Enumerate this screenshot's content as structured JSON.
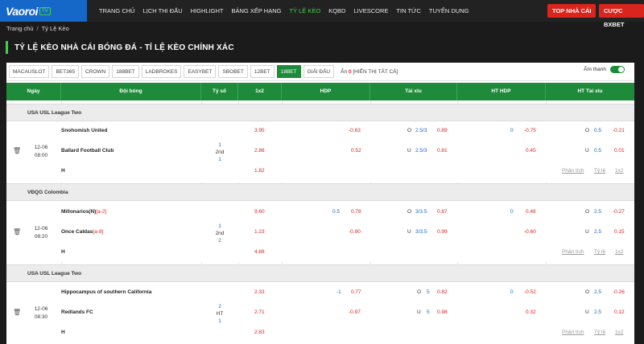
{
  "logo": {
    "text": "Vaoroi",
    "tv": "TV"
  },
  "nav": [
    "TRANG CHỦ",
    "LỊCH THI ĐẤU",
    "HIGHLIGHT",
    "BẢNG XẾP HẠNG",
    "TỶ LỆ KÈO",
    "KQBD",
    "LIVESCORE",
    "TIN TỨC",
    "TUYỂN DỤNG"
  ],
  "nav_active_index": 4,
  "buttons": {
    "top_nha_cai": "TOP NHÀ CÁI",
    "cuoc_bxbet": "CƯỢC BXBET"
  },
  "breadcrumb": {
    "home": "Trang chủ",
    "sep": "/",
    "current": "Tỷ Lệ Kèo"
  },
  "page_title": "TỶ LỆ KÈO NHÀ CÁI BÓNG ĐÁ - TỈ LỆ KÈO CHÍNH XÁC",
  "bookies": [
    "MACAUSLOT",
    "BET365",
    "CROWN",
    "188BET",
    "LADBROKES",
    "EASYBET",
    "SBOBET",
    "12BET",
    "18BET",
    "GIẢI ĐẤU"
  ],
  "bookie_active_index": 8,
  "hide": {
    "label": "Ẩn",
    "count": "0",
    "show_all": "[HIỂN THỊ TẤT CẢ]"
  },
  "sound_label": "Âm thanh",
  "headers": {
    "ngay": "Ngày",
    "doi_bong": "Đội bóng",
    "ty_so": "Tỷ số",
    "x12": "1x2",
    "hdp": "HDP",
    "tai_xiu": "Tài xỉu",
    "ht_hdp": "HT HDP",
    "ht_tai_xiu": "HT Tài xỉu"
  },
  "links": {
    "phan_tich": "Phân tích",
    "ty_le": "Tỷ lệ",
    "x12": "1x2"
  },
  "colors": {
    "green": "#1d8b3a",
    "red": "#d9251d",
    "blue": "#1668c8",
    "nav_bg": "#222222"
  },
  "leagues": [
    {
      "name": "USA USL League Two",
      "date": "12-06",
      "time": "08:00",
      "home": "Snohomish United",
      "home_card": "",
      "away": "Ballard Football Club",
      "away_card": "",
      "draw_label": "H",
      "score_home": "1",
      "period": "2nd",
      "score_away": "1",
      "o1x2": [
        "3.95",
        "2.86",
        "1.82"
      ],
      "hdp": {
        "line_home": "",
        "line_away": "",
        "o_home": "-0.83",
        "o_away": "0.52"
      },
      "tx": {
        "o_label": "O",
        "u_label": "U",
        "line_o": "2.5/3",
        "line_u": "2.5/3",
        "o_val": "0.89",
        "u_val": "0.81"
      },
      "ht_hdp": {
        "line": "0",
        "o_home": "-0.75",
        "o_away": "0.45"
      },
      "ht_tx": {
        "o_label": "O",
        "u_label": "U",
        "line_o": "0.5",
        "line_u": "0.5",
        "o_val": "-0.21",
        "u_val": "0.01"
      }
    },
    {
      "name": "VĐQG Colombia",
      "date": "12-06",
      "time": "08:20",
      "home": "Millonarios(N)",
      "home_card": "[a-2]",
      "away": "Once Caldas",
      "away_card": "[a-8]",
      "draw_label": "H",
      "score_home": "1",
      "period": "2nd",
      "score_away": "2",
      "o1x2": [
        "9.60",
        "1.23",
        "4.88"
      ],
      "hdp": {
        "line_home": "0.5",
        "line_away": "",
        "o_home": "0.78",
        "o_away": "-0.90"
      },
      "tx": {
        "o_label": "O",
        "u_label": "U",
        "line_o": "3/3.5",
        "line_u": "3/3.5",
        "o_val": "0.87",
        "u_val": "0.99"
      },
      "ht_hdp": {
        "line": "0",
        "o_home": "0.48",
        "o_away": "-0.60"
      },
      "ht_tx": {
        "o_label": "O",
        "u_label": "U",
        "line_o": "2.5",
        "line_u": "2.5",
        "o_val": "-0.27",
        "u_val": "0.15"
      }
    },
    {
      "name": "USA USL League Two",
      "date": "12-06",
      "time": "08:30",
      "home": "Hippocampus of southern California",
      "home_card": "",
      "away": "Redlands FC",
      "away_card": "",
      "draw_label": "H",
      "score_home": "2",
      "period": "HT",
      "score_away": "1",
      "o1x2": [
        "2.33",
        "2.71",
        "2.83"
      ],
      "hdp": {
        "line_home": "-1",
        "line_away": "",
        "o_home": "0.77",
        "o_away": "-0.97"
      },
      "tx": {
        "o_label": "O",
        "u_label": "U",
        "line_o": "5",
        "line_u": "5",
        "o_val": "0.82",
        "u_val": "0.98"
      },
      "ht_hdp": {
        "line": "0",
        "o_home": "-0.52",
        "o_away": "0.32"
      },
      "ht_tx": {
        "o_label": "O",
        "u_label": "U",
        "line_o": "2.5",
        "line_u": "2.5",
        "o_val": "-0.26",
        "u_val": "0.12"
      }
    }
  ]
}
